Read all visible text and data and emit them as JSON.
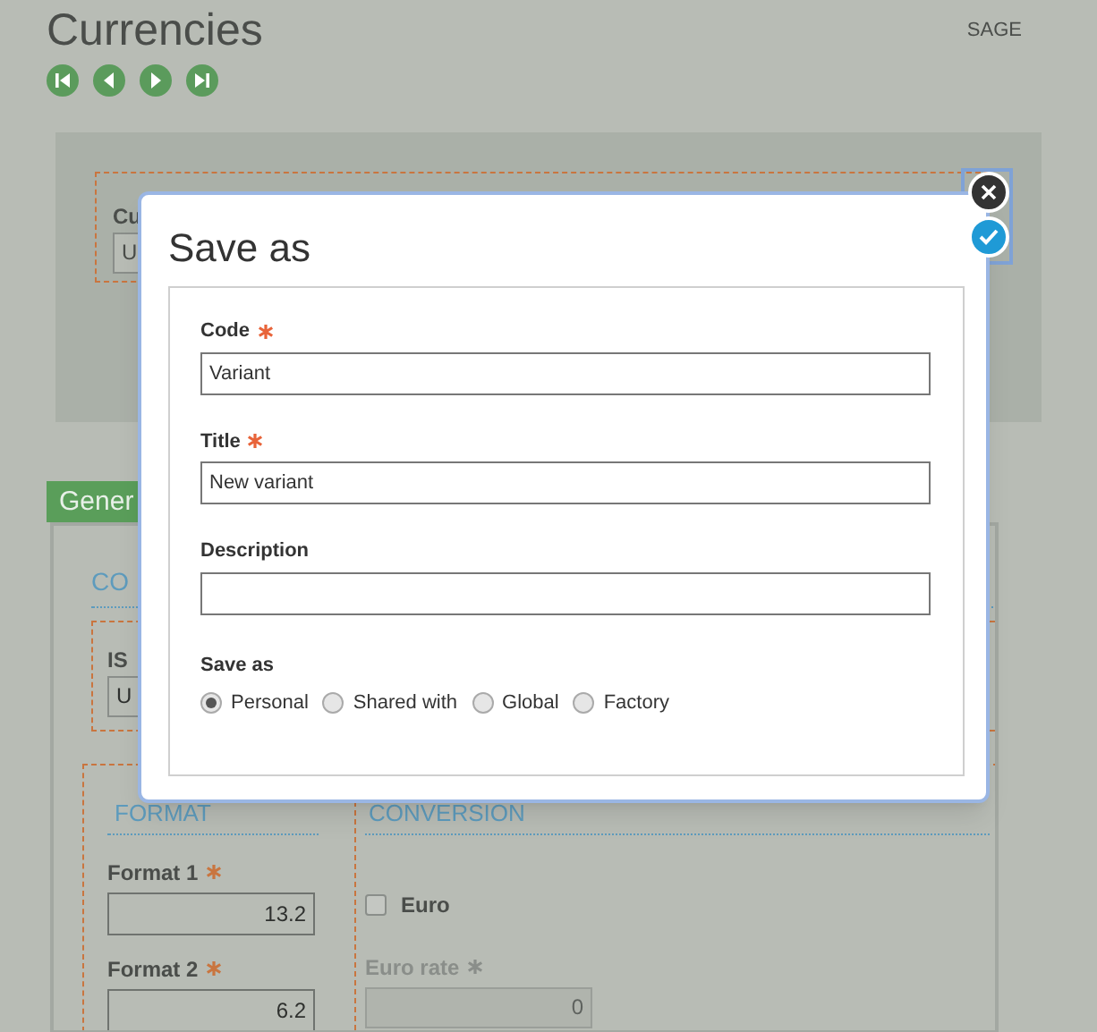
{
  "page": {
    "title": "Currencies",
    "user": "SAGE",
    "nav_buttons": [
      {
        "kind": "first"
      },
      {
        "kind": "previous"
      },
      {
        "kind": "next"
      },
      {
        "kind": "last"
      }
    ]
  },
  "header_block": {
    "field_label": "Cu",
    "field_value": "U"
  },
  "tab": {
    "label": "Gener",
    "selected": true
  },
  "code_section": {
    "title": "CO",
    "field_label": "IS",
    "field_value": "U"
  },
  "format_section": {
    "title": "FORMAT",
    "fields": [
      {
        "label": "Format 1",
        "required": true,
        "value": "13.2"
      },
      {
        "label": "Format 2",
        "required": true,
        "value": "6.2"
      }
    ]
  },
  "conversion_section": {
    "title": "CONVERSION",
    "euro": {
      "label": "Euro",
      "checked": false
    },
    "euro_rate": {
      "label": "Euro rate",
      "required": true,
      "disabled": true,
      "value": "0"
    }
  },
  "dialog": {
    "title": "Save as",
    "fields": [
      {
        "label": "Code",
        "required": true,
        "value": "Variant"
      },
      {
        "label": "Title",
        "required": true,
        "value": "New variant"
      },
      {
        "label": "Description",
        "required": false
      }
    ],
    "save_as": {
      "label": "Save as",
      "options": [
        {
          "label": "Personal",
          "selected": true
        },
        {
          "label": "Shared with",
          "selected": false
        },
        {
          "label": "Global",
          "selected": false
        },
        {
          "label": "Factory",
          "selected": false
        }
      ]
    }
  }
}
